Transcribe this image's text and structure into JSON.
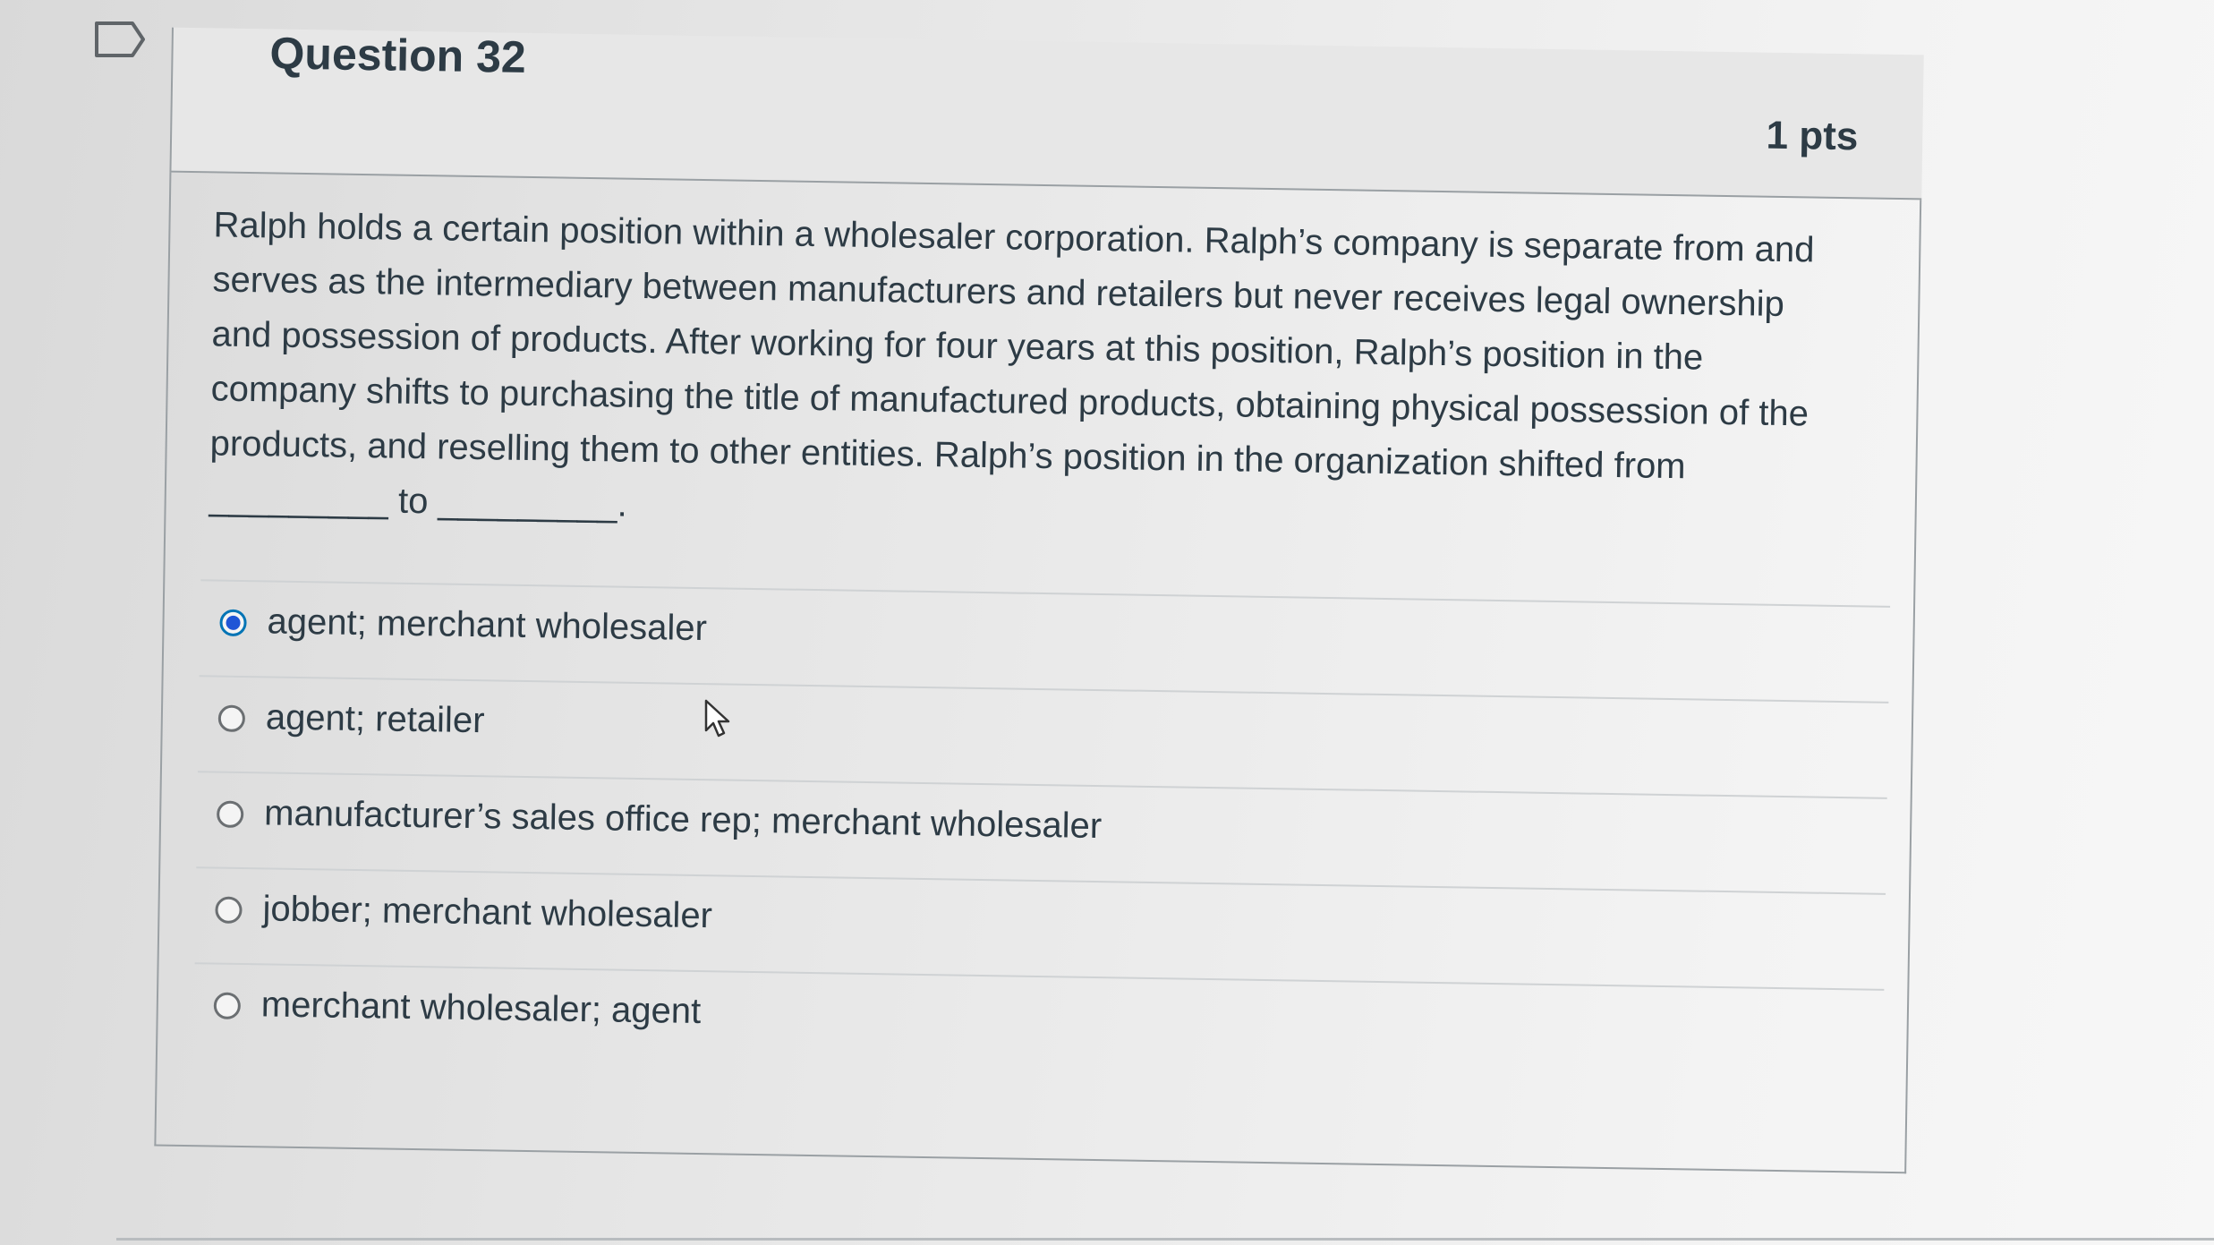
{
  "question": {
    "title": "Question 32",
    "points": "1 pts",
    "text": "Ralph holds a certain position within a wholesaler corporation. Ralph’s company is separate from and serves as the intermediary between manufacturers and retailers but never receives legal ownership and possession of products. After working for four years at this position, Ralph’s position in the company shifts to purchasing the title of manufactured products, obtaining physical possession of the products, and reselling them to other entities. Ralph’s position in the organization shifted from _________ to _________."
  },
  "answers": [
    {
      "label": "agent; merchant wholesaler",
      "selected": true
    },
    {
      "label": "agent; retailer",
      "selected": false
    },
    {
      "label": "manufacturer’s sales office rep; merchant wholesaler",
      "selected": false
    },
    {
      "label": "jobber; merchant wholesaler",
      "selected": false
    },
    {
      "label": "merchant wholesaler; agent",
      "selected": false
    }
  ],
  "icons": {
    "flag": "flag-icon",
    "cursor": "mouse-pointer-icon",
    "radio_selected_color": "#1f55d6"
  }
}
